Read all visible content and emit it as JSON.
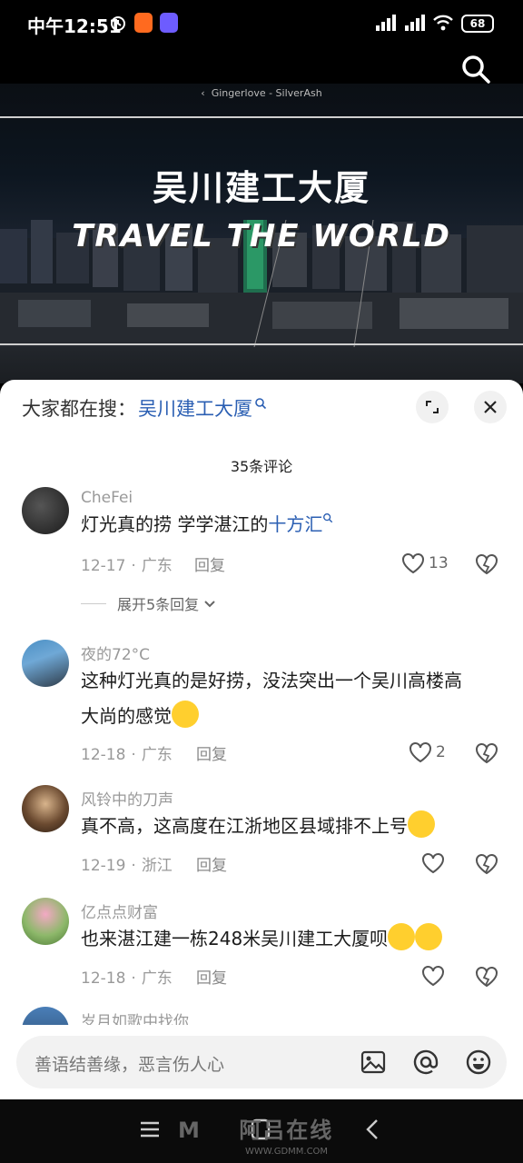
{
  "status": {
    "time": "中午12:51",
    "battery": "68"
  },
  "video": {
    "credit": "Gingerlove - SilverAsh",
    "title": "吴川建工大厦",
    "subtitle": "TRAVEL THE WORLD"
  },
  "sheet": {
    "search_label": "大家都在搜：",
    "search_keyword": "吴川建工大厦",
    "comment_count": "35条评论"
  },
  "comments": [
    {
      "user": "CheFei",
      "text_before": "灯光真的捞 学学湛江的",
      "text_link": "十方汇",
      "date": "12-17",
      "location": "广东",
      "reply": "回复",
      "likes": "13",
      "expand": "展开5条回复"
    },
    {
      "user": "夜的72°C",
      "text_line1": "这种灯光真的是好捞，没法突出一个吴川高楼高",
      "text_line2": "大尚的感觉",
      "date": "12-18",
      "location": "广东",
      "reply": "回复",
      "likes": "2"
    },
    {
      "user": "风铃中的刀声",
      "text": "真不高，这高度在江浙地区县域排不上号",
      "date": "12-19",
      "location": "浙江",
      "reply": "回复"
    },
    {
      "user": "亿点点财富",
      "text": "也来湛江建一栋248米吴川建工大厦呗",
      "date": "12-18",
      "location": "广东",
      "reply": "回复"
    },
    {
      "user": "岁月如歌中找你"
    }
  ],
  "input": {
    "placeholder": "善语结善缘，恶言伤人心"
  },
  "watermark": {
    "text": "阿吕在线",
    "url": "WWW.GDMM.COM"
  },
  "colors": {
    "link": "#2b5fb3",
    "meta": "#999999"
  }
}
